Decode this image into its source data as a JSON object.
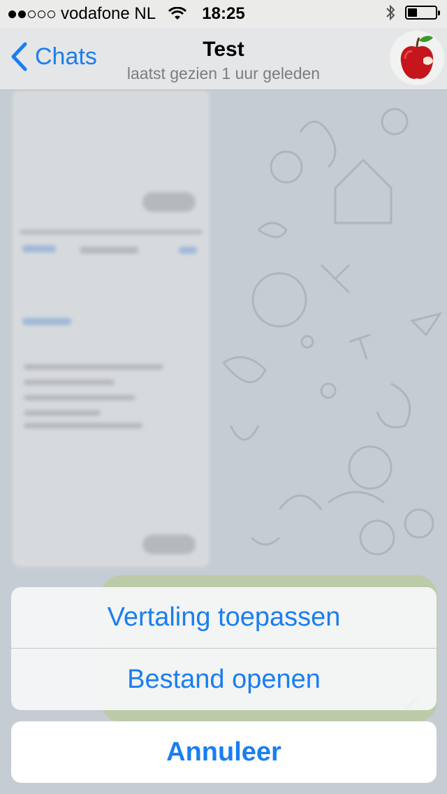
{
  "status_bar": {
    "carrier": "vodafone NL",
    "signal_bars_filled": 2,
    "signal_bars_total": 5,
    "time": "18:25",
    "battery_level": 0.35
  },
  "nav": {
    "back_label": "Chats",
    "title": "Test",
    "subtitle": "laatst gezien 1 uur geleden"
  },
  "action_sheet": {
    "options": [
      "Vertaling toepassen",
      "Bestand openen"
    ],
    "cancel_label": "Annuleer"
  },
  "colors": {
    "accent": "#1a7ef0",
    "chat_background": "#c6ccd3",
    "outgoing_bubble": "#bccba7"
  },
  "icons": {
    "back": "chevron-left-icon",
    "wifi": "wifi-icon",
    "bluetooth": "bluetooth-icon",
    "battery": "battery-icon",
    "avatar": "apple-avatar"
  }
}
